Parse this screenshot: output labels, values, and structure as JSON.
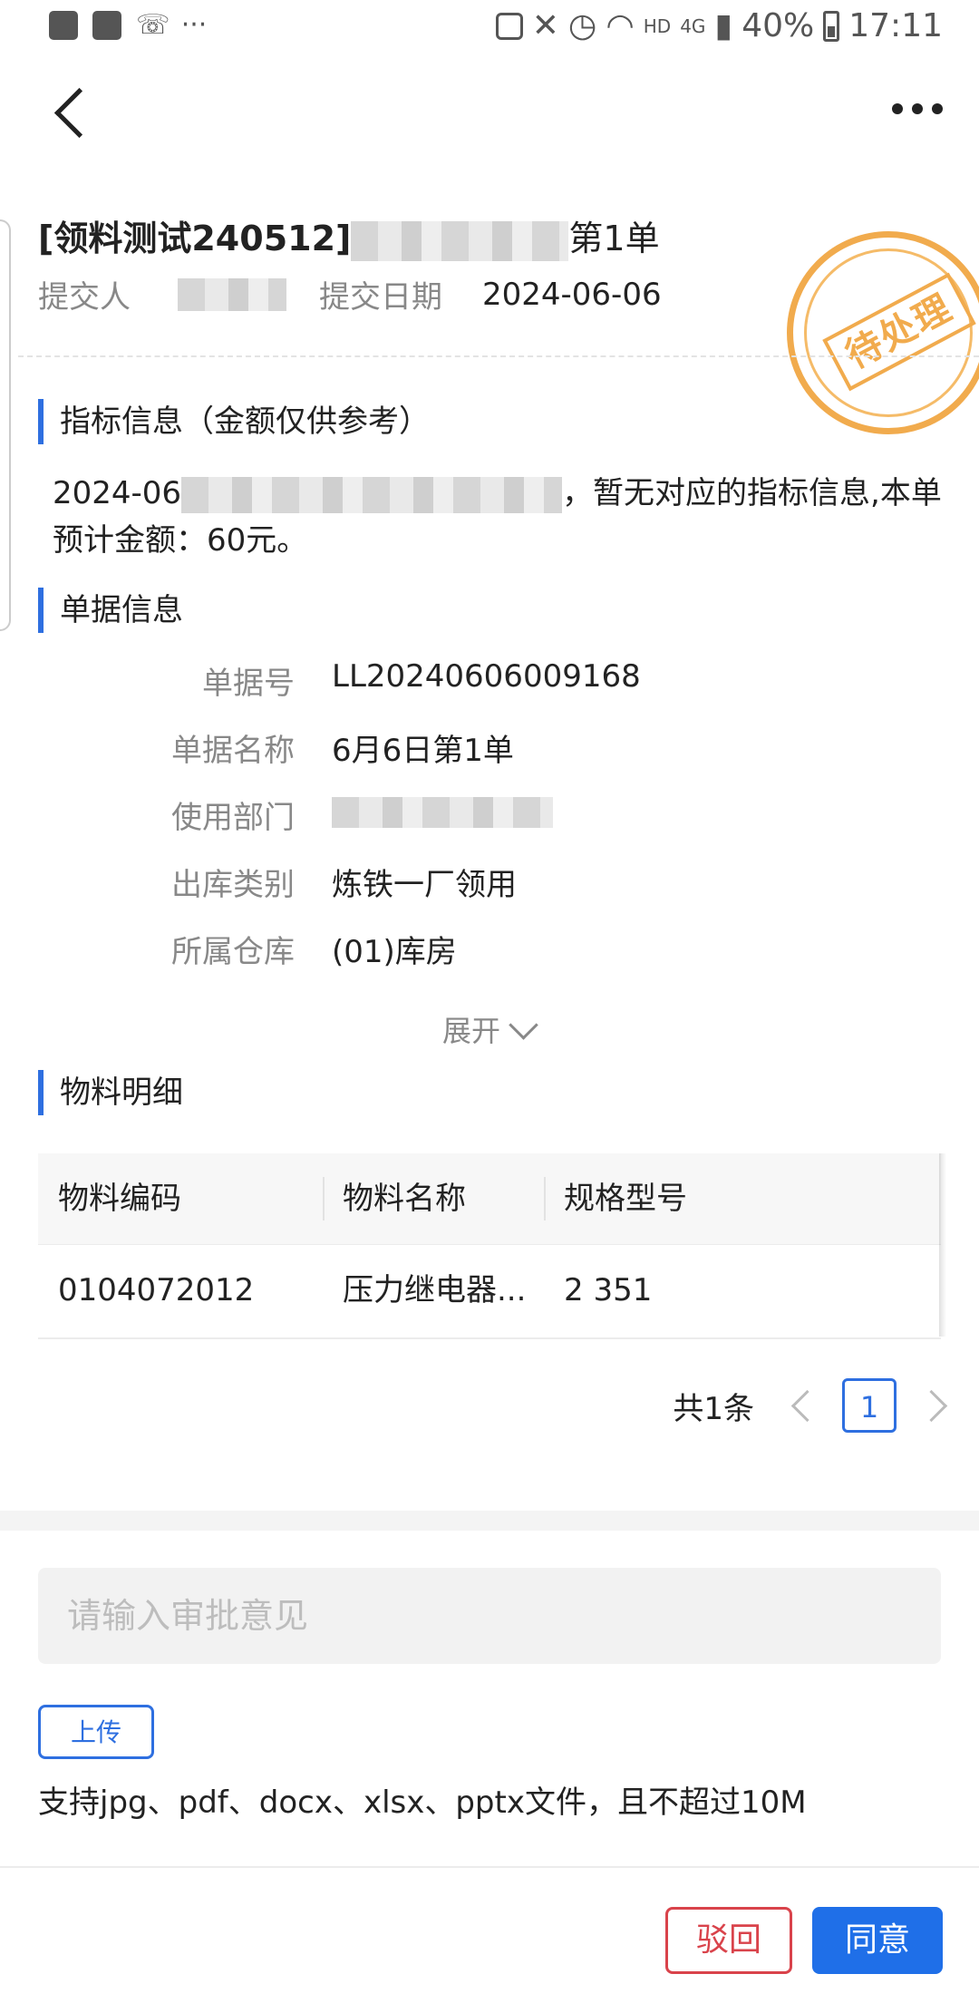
{
  "status_bar": {
    "hd": "HD",
    "network": "4G",
    "battery": "40%",
    "time": "17:11"
  },
  "header": {
    "title_prefix": "[领料测试240512]",
    "title_suffix": "第1单",
    "submitter_label": "提交人",
    "submit_date_label": "提交日期",
    "submit_date": "2024-06-06",
    "stamp_text": "待处理"
  },
  "indicator": {
    "section_title": "指标信息（金额仅供参考）",
    "text_prefix": "2024-06",
    "text_suffix": "，暂无对应的指标信息,本单预计金额：60元。"
  },
  "doc_info": {
    "section_title": "单据信息",
    "fields": [
      {
        "label": "单据号",
        "value": "LL20240606009168"
      },
      {
        "label": "单据名称",
        "value": "6月6日第1单"
      },
      {
        "label": "使用部门",
        "value": ""
      },
      {
        "label": "出库类别",
        "value": "炼铁一厂领用"
      },
      {
        "label": "所属仓库",
        "value": "(01)库房"
      }
    ],
    "expand_label": "展开"
  },
  "materials": {
    "section_title": "物料明细",
    "columns": [
      "物料编码",
      "物料名称",
      "规格型号"
    ],
    "rows": [
      [
        "0104072012",
        "压力继电器...",
        "2 351"
      ]
    ],
    "total_text": "共1条",
    "current_page": "1"
  },
  "approval": {
    "opinion_placeholder": "请输入审批意见",
    "upload_label": "上传",
    "upload_hint": "支持jpg、pdf、docx、xlsx、pptx文件，且不超过10M",
    "reject_label": "驳回",
    "agree_label": "同意"
  }
}
